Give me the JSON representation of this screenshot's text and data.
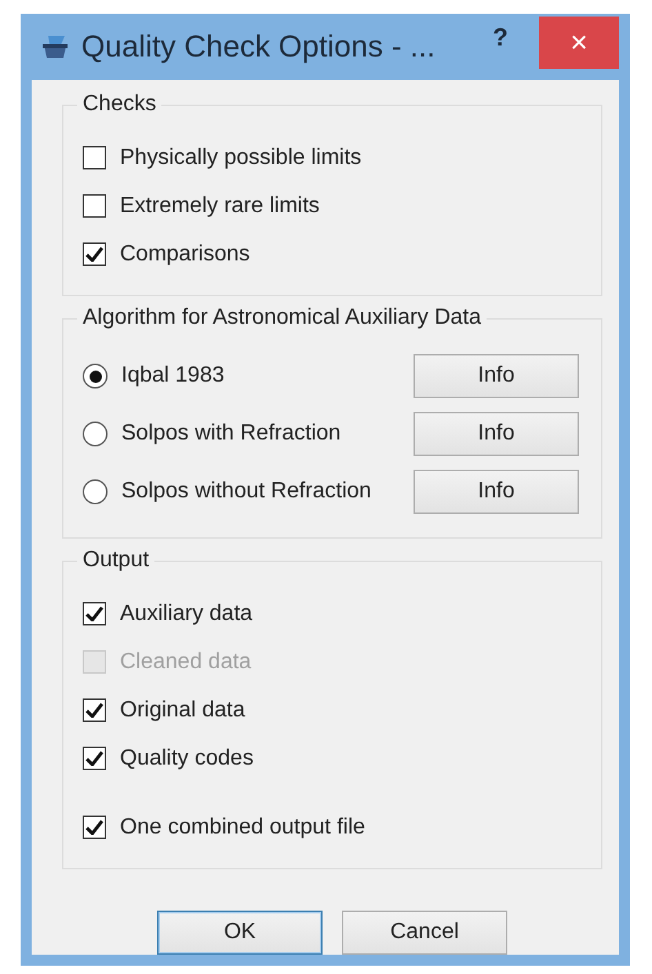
{
  "window": {
    "title": "Quality Check Options - ...",
    "help": "?",
    "close": "×"
  },
  "checks": {
    "title": "Checks",
    "items": [
      {
        "label": "Physically possible limits",
        "checked": false,
        "disabled": false
      },
      {
        "label": "Extremely rare limits",
        "checked": false,
        "disabled": false
      },
      {
        "label": "Comparisons",
        "checked": true,
        "disabled": false
      }
    ]
  },
  "algorithm": {
    "title": "Algorithm for Astronomical Auxiliary Data",
    "options": [
      {
        "label": "Iqbal 1983",
        "selected": true,
        "button": "Info"
      },
      {
        "label": "Solpos with Refraction",
        "selected": false,
        "button": "Info"
      },
      {
        "label": "Solpos without Refraction",
        "selected": false,
        "button": "Info"
      }
    ]
  },
  "output": {
    "title": "Output",
    "items": [
      {
        "label": "Auxiliary data",
        "checked": true,
        "disabled": false
      },
      {
        "label": "Cleaned data",
        "checked": false,
        "disabled": true
      },
      {
        "label": "Original data",
        "checked": true,
        "disabled": false
      },
      {
        "label": "Quality codes",
        "checked": true,
        "disabled": false
      }
    ],
    "combined": {
      "label": "One combined output file",
      "checked": true,
      "disabled": false
    }
  },
  "buttons": [
    {
      "label": "OK",
      "default": true
    },
    {
      "label": "Cancel",
      "default": false
    }
  ]
}
